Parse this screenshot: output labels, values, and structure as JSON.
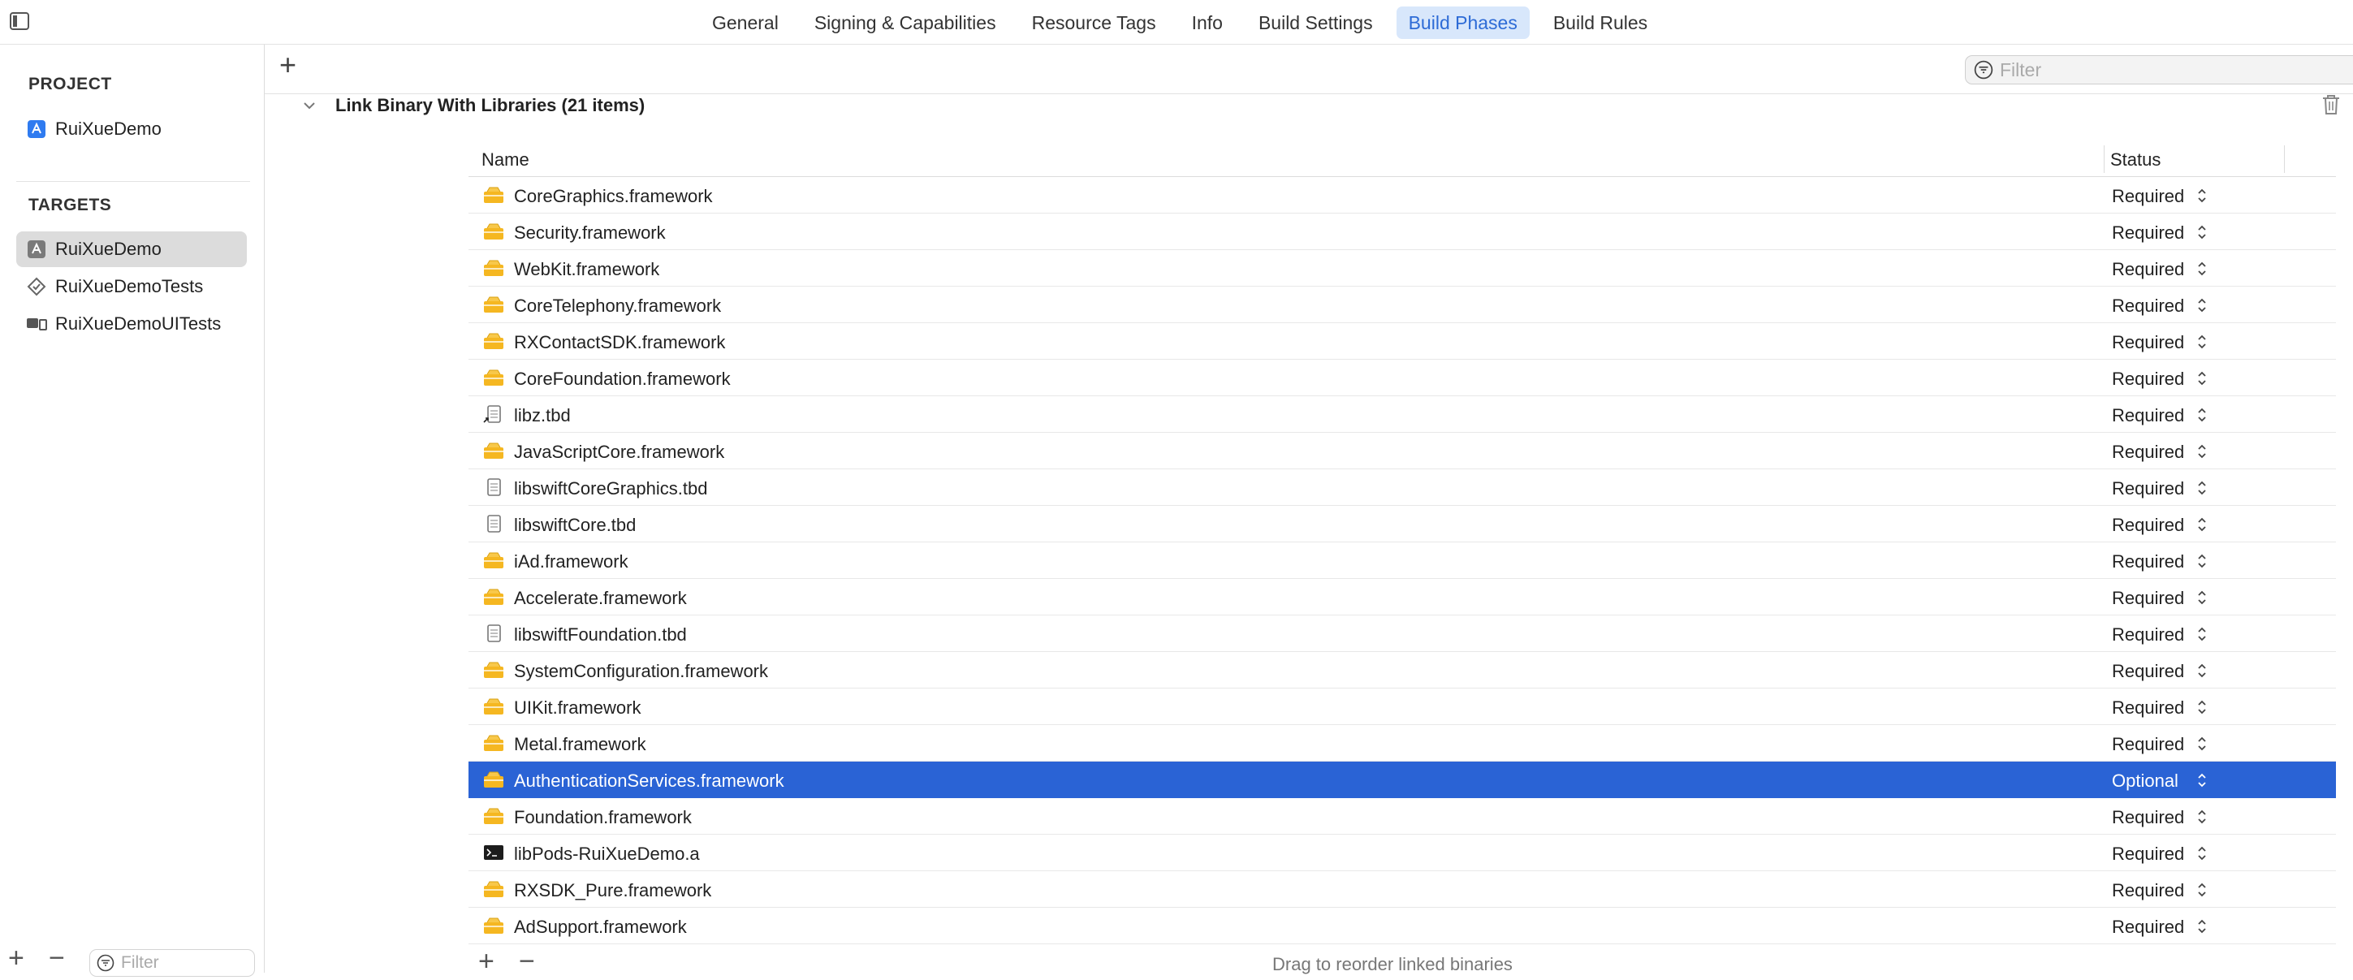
{
  "tabs": [
    "General",
    "Signing & Capabilities",
    "Resource Tags",
    "Info",
    "Build Settings",
    "Build Phases",
    "Build Rules"
  ],
  "active_tab": "Build Phases",
  "navigator": {
    "project_heading": "PROJECT",
    "project_item": "RuiXueDemo",
    "targets_heading": "TARGETS",
    "targets": [
      "RuiXueDemo",
      "RuiXueDemoTests",
      "RuiXueDemoUITests"
    ],
    "selected_target": "RuiXueDemo",
    "filter_placeholder": "Filter",
    "add_label": "+",
    "remove_label": "−"
  },
  "main": {
    "add_label": "+",
    "filter_placeholder": "Filter",
    "phase_title": "Link Binary With Libraries (21 items)",
    "columns": {
      "name": "Name",
      "status": "Status"
    },
    "footer_hint": "Drag to reorder linked binaries",
    "footer_add": "+",
    "footer_remove": "−"
  },
  "libraries": [
    {
      "name": "CoreGraphics.framework",
      "status": "Required",
      "icon": "framework-icon"
    },
    {
      "name": "Security.framework",
      "status": "Required",
      "icon": "framework-icon"
    },
    {
      "name": "WebKit.framework",
      "status": "Required",
      "icon": "framework-icon"
    },
    {
      "name": "CoreTelephony.framework",
      "status": "Required",
      "icon": "framework-icon"
    },
    {
      "name": "RXContactSDK.framework",
      "status": "Required",
      "icon": "framework-icon"
    },
    {
      "name": "CoreFoundation.framework",
      "status": "Required",
      "icon": "framework-icon"
    },
    {
      "name": "libz.tbd",
      "status": "Required",
      "icon": "alias-document-icon"
    },
    {
      "name": "JavaScriptCore.framework",
      "status": "Required",
      "icon": "framework-icon"
    },
    {
      "name": "libswiftCoreGraphics.tbd",
      "status": "Required",
      "icon": "document-icon"
    },
    {
      "name": "libswiftCore.tbd",
      "status": "Required",
      "icon": "document-icon"
    },
    {
      "name": "iAd.framework",
      "status": "Required",
      "icon": "framework-icon"
    },
    {
      "name": "Accelerate.framework",
      "status": "Required",
      "icon": "framework-icon"
    },
    {
      "name": "libswiftFoundation.tbd",
      "status": "Required",
      "icon": "document-icon"
    },
    {
      "name": "SystemConfiguration.framework",
      "status": "Required",
      "icon": "framework-icon"
    },
    {
      "name": "UIKit.framework",
      "status": "Required",
      "icon": "framework-icon"
    },
    {
      "name": "Metal.framework",
      "status": "Required",
      "icon": "framework-icon"
    },
    {
      "name": "AuthenticationServices.framework",
      "status": "Optional",
      "icon": "framework-icon",
      "selected": true
    },
    {
      "name": "Foundation.framework",
      "status": "Required",
      "icon": "framework-icon"
    },
    {
      "name": "libPods-RuiXueDemo.a",
      "status": "Required",
      "icon": "terminal-icon"
    },
    {
      "name": "RXSDK_Pure.framework",
      "status": "Required",
      "icon": "framework-icon"
    },
    {
      "name": "AdSupport.framework",
      "status": "Required",
      "icon": "framework-icon"
    }
  ],
  "colors": {
    "accent": "#2a63d5",
    "tab_active_bg": "#d8e7fb",
    "framework_icon": "#f5b721"
  }
}
